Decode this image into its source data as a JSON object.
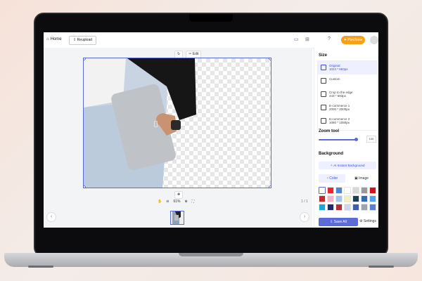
{
  "topbar": {
    "home_label": "Home",
    "reupload_label": "Reupload",
    "purchase_label": "Purchase"
  },
  "canvas": {
    "edit_label": "Edit",
    "zoom_percent": "61%",
    "page_count": "1 / 1"
  },
  "panel": {
    "size_title": "Size",
    "sizes": [
      {
        "name": "Original",
        "dims": "1024 * 683px"
      },
      {
        "name": "Custom",
        "dims": ""
      },
      {
        "name": "Crop to the edge",
        "dims": "443 * 683px"
      },
      {
        "name": "E-commerce 1",
        "dims": "2000 * 2000px"
      },
      {
        "name": "E-commerce 2",
        "dims": "1080 * 1080px"
      }
    ],
    "zoom_title": "Zoom tool",
    "zoom_value": "100",
    "zoom_level": 0.95,
    "background_title": "Background",
    "ai_button_label": "AI Instant Background",
    "tab_color": "Color",
    "tab_image": "Image",
    "swatches": [
      "#ffffff",
      "#e8262c",
      "#4a88d4",
      "#ffffff",
      "#d9d9d9",
      "#9a9a9a",
      "#d0121b",
      "#c02a2a",
      "#f4b5c9",
      "#a8c6ea",
      "#f5f0c0",
      "#1c3f57",
      "#2f6fb0",
      "#4fa3e8",
      "#1aa9d6",
      "#1e2c6e",
      "#b1313a",
      "#cfd6e6",
      "#3f5fa8",
      "#9fa3b0",
      "#5b7fd1"
    ],
    "save_all_label": "Save All",
    "settings_label": "Settings"
  },
  "colors": {
    "accent": "#5b6bd8",
    "purchase": "#f7a11a"
  }
}
